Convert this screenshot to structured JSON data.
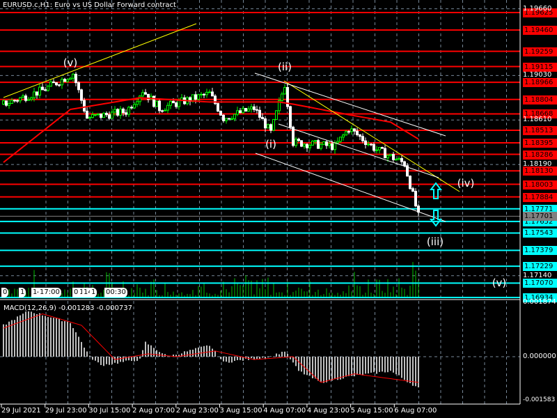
{
  "window": {
    "title": "EURUSD.c,H1:  Euro vs US Dollar Forward contract"
  },
  "colors": {
    "resistance": "#ff0000",
    "support": "#00ffff",
    "bull": "#00ff00",
    "bear": "#ffffff",
    "trend": "#ffff00",
    "ma": "#ff0000",
    "bid": "#808080",
    "volume": "#00c000",
    "grid": "#778899"
  },
  "price_axis": {
    "levels_red": [
      "1.19625",
      "1.19460",
      "1.19259",
      "1.19115",
      "1.18966",
      "1.18804",
      "1.18668",
      "1.18513",
      "1.18395",
      "1.18286",
      "1.18130",
      "1.18003",
      "1.17884"
    ],
    "levels_cyan": [
      "1.17771",
      "1.17652",
      "1.17543",
      "1.17379",
      "1.17229",
      "1.17070",
      "1.16934"
    ],
    "bid": "1.17701",
    "ticks": [
      "1.19660",
      "1.19030",
      "1.18610",
      "1.18190",
      "1.17140"
    ]
  },
  "time_axis": [
    "29 Jul 2021",
    "29 Jul 23:00",
    "30 Jul 15:00",
    "2 Aug 07:00",
    "2 Aug 23:00",
    "3 Aug 15:00",
    "4 Aug 07:00",
    "4 Aug 23:00",
    "5 Aug 15:00",
    "6 Aug 07:00"
  ],
  "time_overlay": [
    "0",
    "1",
    "14",
    "17:00",
    "09",
    "1",
    "14",
    "1",
    "00:30"
  ],
  "wave_labels": [
    {
      "text": "(v)",
      "price": 1.1915,
      "index": 24
    },
    {
      "text": "(ii)",
      "price": 1.1911,
      "index": 101
    },
    {
      "text": "(i)",
      "price": 1.1838,
      "index": 96
    },
    {
      "text": "(iv)",
      "price": 1.1801,
      "index": 166
    },
    {
      "text": "(iii)",
      "price": 1.1746,
      "index": 155
    },
    {
      "text": "(v)",
      "price": 1.1707,
      "index": 178
    }
  ],
  "macd": {
    "title": "MACD(12,26,9) -0.001283 -0.000737",
    "top": "0.001874",
    "zero": "0.000000",
    "bottom": "-0.001583"
  },
  "chart_data": {
    "type": "candlestick",
    "symbol": "EURUSD.c",
    "timeframe": "H1",
    "ylim": [
      1.16934,
      1.19625
    ],
    "price_path": [
      [
        0,
        1.1876
      ],
      [
        14,
        1.1889
      ],
      [
        25,
        1.1905
      ],
      [
        30,
        1.1863
      ],
      [
        44,
        1.1869
      ],
      [
        50,
        1.1889
      ],
      [
        56,
        1.1872
      ],
      [
        74,
        1.1886
      ],
      [
        79,
        1.1863
      ],
      [
        90,
        1.1872
      ],
      [
        96,
        1.1849
      ],
      [
        101,
        1.1895
      ],
      [
        104,
        1.184
      ],
      [
        119,
        1.1836
      ],
      [
        124,
        1.1853
      ],
      [
        134,
        1.1833
      ],
      [
        144,
        1.182
      ],
      [
        149,
        1.177
      ]
    ],
    "ma_path": [
      [
        0,
        1.1821
      ],
      [
        24,
        1.1871
      ],
      [
        49,
        1.1882
      ],
      [
        74,
        1.1878
      ],
      [
        99,
        1.1878
      ],
      [
        104,
        1.1876
      ],
      [
        124,
        1.1866
      ],
      [
        139,
        1.1859
      ],
      [
        149,
        1.1843
      ]
    ],
    "macd_hist": [
      [
        0,
        0.0011
      ],
      [
        9,
        0.0016
      ],
      [
        24,
        0.0012
      ],
      [
        31,
        0.0
      ],
      [
        35,
        -0.0003
      ],
      [
        49,
        -0.0001
      ],
      [
        51,
        0.0005
      ],
      [
        59,
        0.0
      ],
      [
        74,
        0.0004
      ],
      [
        79,
        -0.0002
      ],
      [
        96,
        0.0
      ],
      [
        101,
        0.0002
      ],
      [
        106,
        -0.0005
      ],
      [
        114,
        -0.0009
      ],
      [
        124,
        -0.0007
      ],
      [
        139,
        -0.0005
      ],
      [
        149,
        -0.0011
      ]
    ],
    "macd_signal": [
      [
        0,
        0.001
      ],
      [
        14,
        0.0015
      ],
      [
        28,
        0.0011
      ],
      [
        40,
        -0.0001
      ],
      [
        52,
        0.0001
      ],
      [
        62,
        0.0
      ],
      [
        76,
        0.0002
      ],
      [
        90,
        -0.0001
      ],
      [
        104,
        0.0
      ],
      [
        114,
        -0.0009
      ],
      [
        126,
        -0.0006
      ],
      [
        149,
        -0.0009
      ]
    ]
  }
}
